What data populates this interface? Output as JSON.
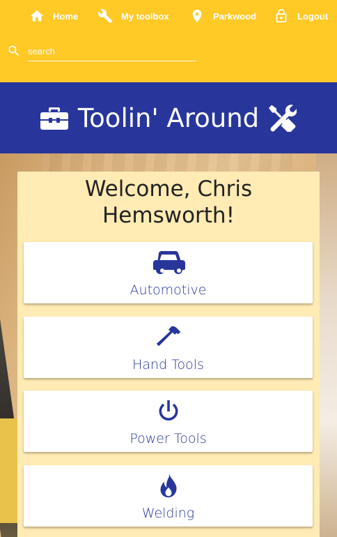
{
  "nav": {
    "home": {
      "label": "Home",
      "icon": "home-icon"
    },
    "toolbox": {
      "label": "My toolbox",
      "icon": "wrench-icon"
    },
    "location": {
      "label": "Parkwood",
      "icon": "location-pin-icon"
    },
    "logout": {
      "label": "Logout",
      "icon": "lock-icon"
    }
  },
  "search": {
    "placeholder": "search",
    "icon": "search-icon"
  },
  "brand": {
    "title": "Toolin' Around",
    "left_icon": "toolbox-icon",
    "right_icon": "tools-icon"
  },
  "welcome": {
    "text": "Welcome, Chris Hemsworth!"
  },
  "categories": [
    {
      "label": "Automotive",
      "icon": "car-icon"
    },
    {
      "label": "Hand Tools",
      "icon": "hammer-icon"
    },
    {
      "label": "Power Tools",
      "icon": "power-icon"
    },
    {
      "label": "Welding",
      "icon": "flame-icon"
    }
  ],
  "colors": {
    "topbar": "#ffc926",
    "brand": "#28369b",
    "panel": "#ffebb3",
    "accent": "#28369b"
  }
}
